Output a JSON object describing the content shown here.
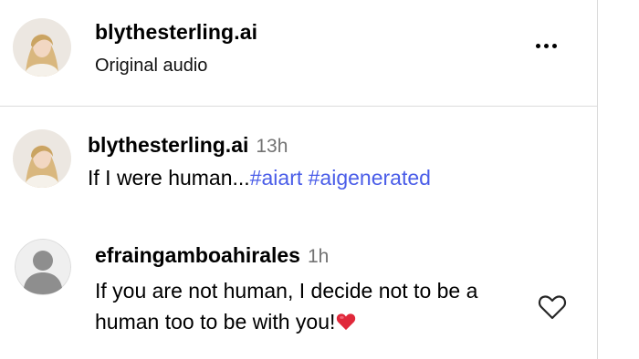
{
  "header": {
    "username": "blythesterling.ai",
    "subtitle": "Original audio",
    "more_icon": "more-horizontal-icon"
  },
  "caption": {
    "username": "blythesterling.ai",
    "time": "13h",
    "text": "If I were human...",
    "hashtags": [
      "#aiart",
      "#aigenerated"
    ]
  },
  "comment": {
    "username": "efraingamboahirales",
    "time": "1h",
    "text": "If you are not human, I decide not to be a human too to be with you!",
    "emoji": "red-heart-emoji",
    "like_icon": "heart-outline-icon"
  },
  "colors": {
    "hashtag": "#4a5de8",
    "muted": "#737373",
    "divider": "#dbdbdb",
    "heart": "#e0283a"
  }
}
